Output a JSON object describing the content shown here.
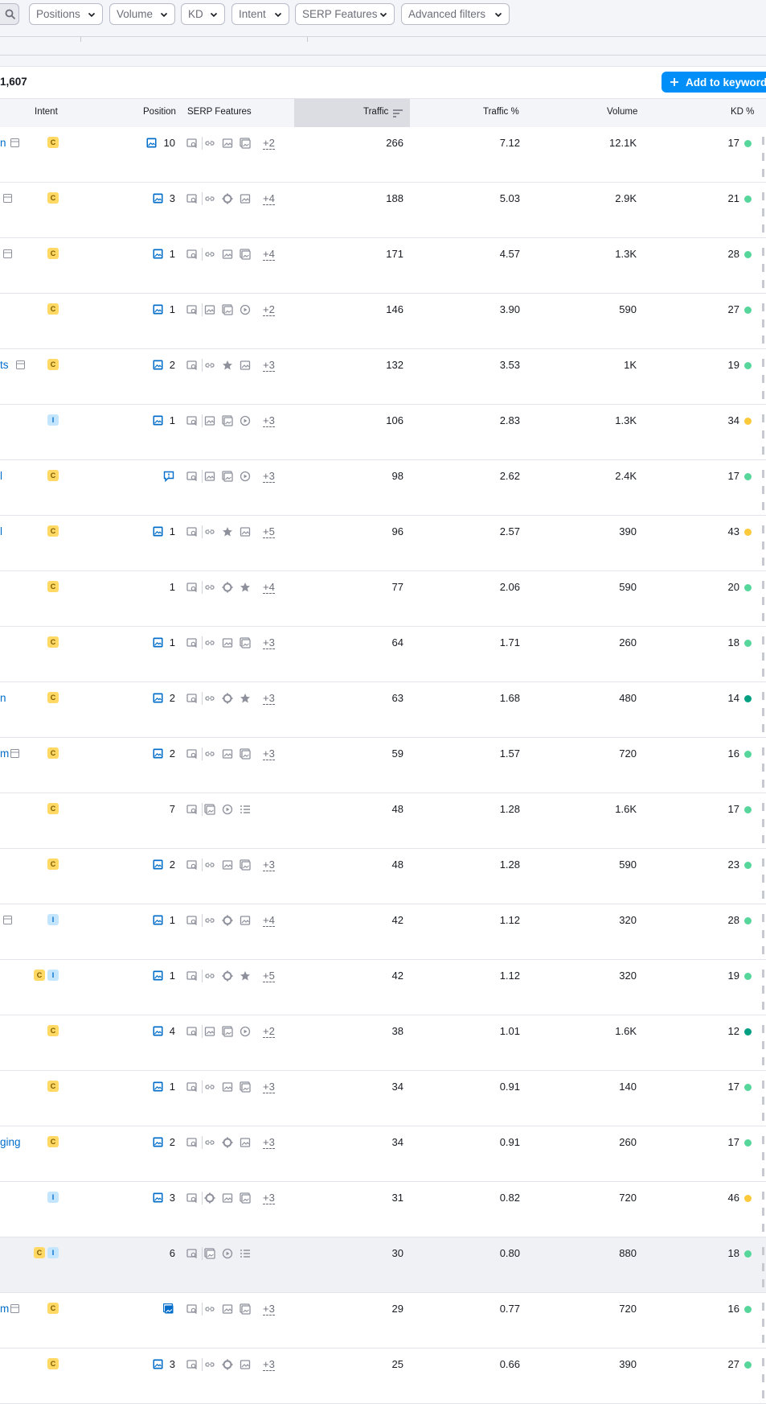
{
  "filters": {
    "positions": "Positions",
    "volume": "Volume",
    "kd": "KD",
    "intent": "Intent",
    "serp_features": "SERP Features",
    "advanced": "Advanced filters"
  },
  "summary": {
    "count": "1,607",
    "add_button": "Add to keyword l"
  },
  "columns": {
    "intent": "Intent",
    "position": "Position",
    "serp": "SERP Features",
    "traffic": "Traffic",
    "traffic_pct": "Traffic %",
    "volume": "Volume",
    "kd": "KD %"
  },
  "colors": {
    "easy": "#56d69b",
    "very_easy": "#009f81",
    "possible": "#fcc93b",
    "link": "#006dca",
    "button": "#008ff8"
  },
  "rows": [
    {
      "kw": "n",
      "kwicon": true,
      "intent": [
        "C"
      ],
      "posimg": "image",
      "pos": "10",
      "serp": [
        "map",
        "link",
        "image",
        "image2"
      ],
      "more": "+2",
      "traffic": "266",
      "tpct": "7.12",
      "volume": "12.1K",
      "kd": "17",
      "kdc": "easy"
    },
    {
      "kw": "",
      "kwicon": true,
      "intent": [
        "C"
      ],
      "posimg": "image",
      "pos": "3",
      "serp": [
        "map",
        "link",
        "crosshair",
        "image"
      ],
      "more": "+4",
      "traffic": "188",
      "tpct": "5.03",
      "volume": "2.9K",
      "kd": "21",
      "kdc": "easy"
    },
    {
      "kw": "",
      "kwicon": true,
      "intent": [
        "C"
      ],
      "posimg": "image",
      "pos": "1",
      "serp": [
        "map",
        "link",
        "image",
        "image2"
      ],
      "more": "+4",
      "traffic": "171",
      "tpct": "4.57",
      "volume": "1.3K",
      "kd": "28",
      "kdc": "easy"
    },
    {
      "kw": "",
      "kwicon": false,
      "intent": [
        "C"
      ],
      "posimg": "image",
      "pos": "1",
      "serp": [
        "map",
        "image",
        "image2",
        "video"
      ],
      "more": "+2",
      "traffic": "146",
      "tpct": "3.90",
      "volume": "590",
      "kd": "27",
      "kdc": "easy"
    },
    {
      "kw": "ts",
      "kwicon": true,
      "intent": [
        "C"
      ],
      "posimg": "image",
      "pos": "2",
      "serp": [
        "map",
        "link",
        "star",
        "image"
      ],
      "more": "+3",
      "traffic": "132",
      "tpct": "3.53",
      "volume": "1K",
      "kd": "19",
      "kdc": "easy"
    },
    {
      "kw": "",
      "kwicon": false,
      "intent": [
        "I"
      ],
      "posimg": "image",
      "pos": "1",
      "serp": [
        "map",
        "image",
        "image2",
        "video"
      ],
      "more": "+3",
      "traffic": "106",
      "tpct": "2.83",
      "volume": "1.3K",
      "kd": "34",
      "kdc": "possible"
    },
    {
      "kw": "l",
      "kwicon": false,
      "intent": [
        "C"
      ],
      "posimg": "faq",
      "pos": "",
      "serp": [
        "map",
        "image",
        "image2",
        "video"
      ],
      "more": "+3",
      "traffic": "98",
      "tpct": "2.62",
      "volume": "2.4K",
      "kd": "17",
      "kdc": "easy"
    },
    {
      "kw": "l",
      "kwicon": false,
      "intent": [
        "C"
      ],
      "posimg": "image",
      "pos": "1",
      "serp": [
        "map",
        "link",
        "star",
        "image"
      ],
      "more": "+5",
      "traffic": "96",
      "tpct": "2.57",
      "volume": "390",
      "kd": "43",
      "kdc": "possible"
    },
    {
      "kw": "",
      "kwicon": false,
      "intent": [
        "C"
      ],
      "posimg": "",
      "pos": "1",
      "serp": [
        "map",
        "link",
        "crosshair",
        "star"
      ],
      "more": "+4",
      "traffic": "77",
      "tpct": "2.06",
      "volume": "590",
      "kd": "20",
      "kdc": "easy"
    },
    {
      "kw": "",
      "kwicon": false,
      "intent": [
        "C"
      ],
      "posimg": "image",
      "pos": "1",
      "serp": [
        "map",
        "link",
        "image",
        "image2"
      ],
      "more": "+3",
      "traffic": "64",
      "tpct": "1.71",
      "volume": "260",
      "kd": "18",
      "kdc": "easy"
    },
    {
      "kw": "n",
      "kwicon": false,
      "intent": [
        "C"
      ],
      "posimg": "image",
      "pos": "2",
      "serp": [
        "map",
        "link",
        "crosshair",
        "star"
      ],
      "more": "+3",
      "traffic": "63",
      "tpct": "1.68",
      "volume": "480",
      "kd": "14",
      "kdc": "very_easy"
    },
    {
      "kw": "m",
      "kwicon": true,
      "intent": [
        "C"
      ],
      "posimg": "image",
      "pos": "2",
      "serp": [
        "map",
        "link",
        "image",
        "image2"
      ],
      "more": "+3",
      "traffic": "59",
      "tpct": "1.57",
      "volume": "720",
      "kd": "16",
      "kdc": "easy"
    },
    {
      "kw": "",
      "kwicon": false,
      "intent": [
        "C"
      ],
      "posimg": "",
      "pos": "7",
      "serp": [
        "map",
        "image2",
        "video",
        "list"
      ],
      "more": "",
      "traffic": "48",
      "tpct": "1.28",
      "volume": "1.6K",
      "kd": "17",
      "kdc": "easy"
    },
    {
      "kw": "",
      "kwicon": false,
      "intent": [
        "C"
      ],
      "posimg": "image",
      "pos": "2",
      "serp": [
        "map",
        "link",
        "image",
        "image2"
      ],
      "more": "+3",
      "traffic": "48",
      "tpct": "1.28",
      "volume": "590",
      "kd": "23",
      "kdc": "easy"
    },
    {
      "kw": "",
      "kwicon": true,
      "intent": [
        "I"
      ],
      "posimg": "image",
      "pos": "1",
      "serp": [
        "map",
        "link",
        "crosshair",
        "image"
      ],
      "more": "+4",
      "traffic": "42",
      "tpct": "1.12",
      "volume": "320",
      "kd": "28",
      "kdc": "easy"
    },
    {
      "kw": "",
      "kwicon": false,
      "intent": [
        "C",
        "I"
      ],
      "posimg": "image",
      "pos": "1",
      "serp": [
        "map",
        "link",
        "crosshair",
        "star"
      ],
      "more": "+5",
      "traffic": "42",
      "tpct": "1.12",
      "volume": "320",
      "kd": "19",
      "kdc": "easy"
    },
    {
      "kw": "",
      "kwicon": false,
      "intent": [
        "C"
      ],
      "posimg": "image",
      "pos": "4",
      "serp": [
        "map",
        "image",
        "image2",
        "video"
      ],
      "more": "+2",
      "traffic": "38",
      "tpct": "1.01",
      "volume": "1.6K",
      "kd": "12",
      "kdc": "very_easy"
    },
    {
      "kw": "",
      "kwicon": false,
      "intent": [
        "C"
      ],
      "posimg": "image",
      "pos": "1",
      "serp": [
        "map",
        "link",
        "image",
        "image2"
      ],
      "more": "+3",
      "traffic": "34",
      "tpct": "0.91",
      "volume": "140",
      "kd": "17",
      "kdc": "easy"
    },
    {
      "kw": "ging",
      "kwicon": false,
      "intent": [
        "C"
      ],
      "posimg": "image",
      "pos": "2",
      "serp": [
        "map",
        "link",
        "crosshair",
        "image"
      ],
      "more": "+3",
      "traffic": "34",
      "tpct": "0.91",
      "volume": "260",
      "kd": "17",
      "kdc": "easy"
    },
    {
      "kw": "",
      "kwicon": false,
      "intent": [
        "I"
      ],
      "posimg": "image",
      "pos": "3",
      "serp": [
        "map",
        "crosshair",
        "image",
        "image2"
      ],
      "more": "+3",
      "traffic": "31",
      "tpct": "0.82",
      "volume": "720",
      "kd": "46",
      "kdc": "possible"
    },
    {
      "kw": "",
      "kwicon": false,
      "intent": [
        "C",
        "I"
      ],
      "posimg": "",
      "pos": "6",
      "serp": [
        "map",
        "image2",
        "video",
        "list"
      ],
      "more": "",
      "traffic": "30",
      "tpct": "0.80",
      "volume": "880",
      "kd": "18",
      "kdc": "easy",
      "hl": true
    },
    {
      "kw": "m",
      "kwicon": true,
      "intent": [
        "C"
      ],
      "posimg": "image2",
      "pos": "",
      "serp": [
        "map",
        "link",
        "image",
        "image2"
      ],
      "more": "+3",
      "traffic": "29",
      "tpct": "0.77",
      "volume": "720",
      "kd": "16",
      "kdc": "easy"
    },
    {
      "kw": "",
      "kwicon": false,
      "intent": [
        "C"
      ],
      "posimg": "image",
      "pos": "3",
      "serp": [
        "map",
        "link",
        "crosshair",
        "image"
      ],
      "more": "+3",
      "traffic": "25",
      "tpct": "0.66",
      "volume": "390",
      "kd": "27",
      "kdc": "easy"
    }
  ]
}
